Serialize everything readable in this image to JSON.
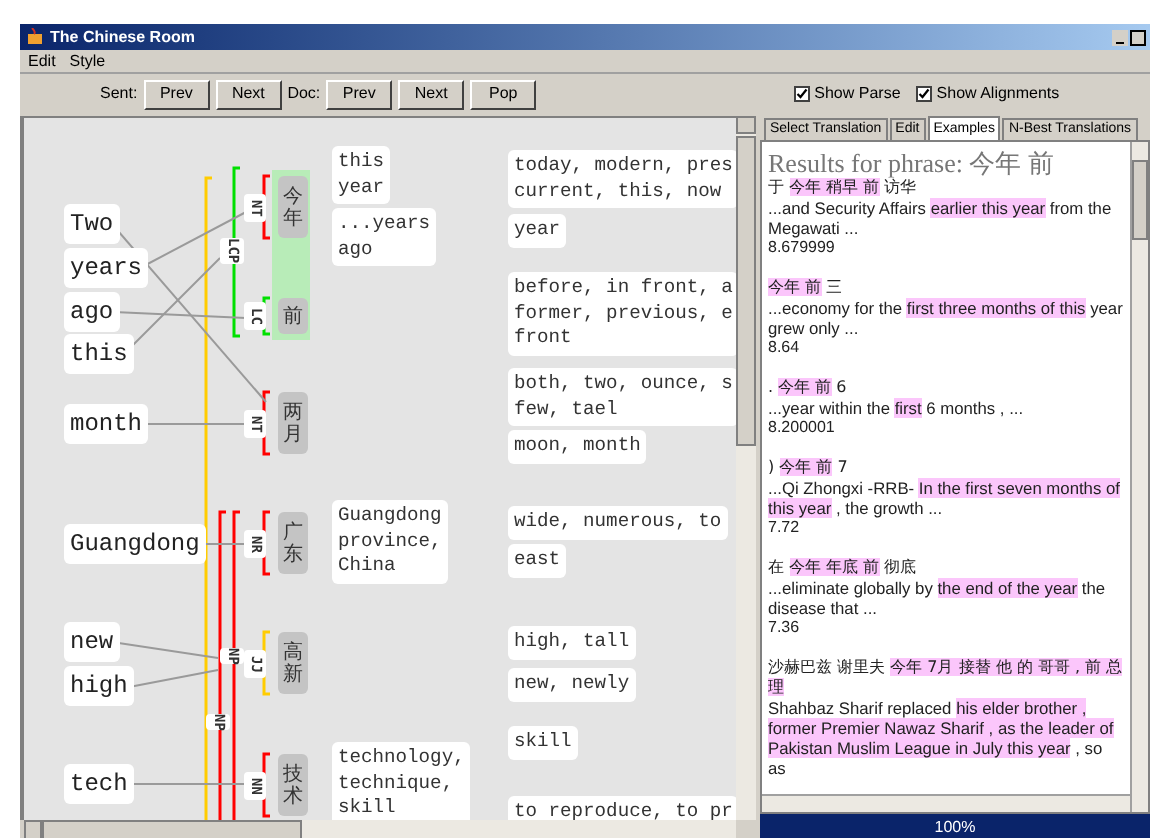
{
  "window": {
    "title": "The Chinese Room"
  },
  "menu": [
    "Edit",
    "Style"
  ],
  "toolbar": {
    "sent_label": "Sent:",
    "sent_buttons": [
      "Prev",
      "Next"
    ],
    "doc_label": "Doc:",
    "doc_buttons": [
      "Prev",
      "Next",
      "Pop"
    ],
    "checkboxes": [
      {
        "label": "Show Parse",
        "checked": true
      },
      {
        "label": "Show Alignments",
        "checked": true
      }
    ]
  },
  "parse": {
    "english_words": [
      {
        "text": "Two"
      },
      {
        "text": "years"
      },
      {
        "text": "ago"
      },
      {
        "text": "this"
      },
      {
        "text": "month"
      },
      {
        "text": "Guangdong"
      },
      {
        "text": "new"
      },
      {
        "text": "high"
      },
      {
        "text": "tech"
      }
    ],
    "chinese_words": [
      {
        "text": "今年",
        "tag": "NT",
        "color": "#ff0000",
        "selected": true
      },
      {
        "text": "前",
        "tag": "LC",
        "color": "#00e000",
        "selected": true
      },
      {
        "text": "两月",
        "tag": "NT",
        "color": "#ff0000",
        "selected": false
      },
      {
        "text": "广东",
        "tag": "NR",
        "color": "#ff0000",
        "selected": false
      },
      {
        "text": "高新",
        "tag": "JJ",
        "color": "#ffcc00",
        "selected": false
      },
      {
        "text": "技术",
        "tag": "NN",
        "color": "#ff0000",
        "selected": false
      }
    ],
    "phrases": [
      {
        "tag": "LCP",
        "color": "#00e000"
      },
      {
        "tag": "NP",
        "color": "#ff0000"
      },
      {
        "tag": "NP",
        "color": "#ff0000"
      },
      {
        "color": "#ffcc00"
      }
    ],
    "glosses": [
      "this\nyear",
      "...years\nago",
      "Guangdong\nprovince,\nChina",
      "technology,\ntechnique,\nskill"
    ],
    "dictionary": [
      "today, modern, pres\ncurrent, this, now",
      "year",
      "before, in front, a\nformer, previous, e\nfront",
      "both, two, ounce, s\nfew, tael",
      "moon, month",
      "wide, numerous, to",
      "east",
      "high, tall",
      "new, newly",
      "skill",
      "to reproduce, to pr"
    ]
  },
  "tabs": [
    {
      "label": "Select Translation",
      "selected": false
    },
    {
      "label": "Edit",
      "selected": false
    },
    {
      "label": "Examples",
      "selected": true
    },
    {
      "label": "N-Best Translations",
      "selected": false
    }
  ],
  "examples": {
    "heading": "Results for phrase: 今年 前",
    "items": [
      {
        "chinese": [
          {
            "text": "于 ",
            "highlighted": false
          },
          {
            "text": "今年 稍早 前",
            "highlighted": true
          },
          {
            "text": " 访华",
            "highlighted": false
          }
        ],
        "english": [
          {
            "text": "...and Security Affairs ",
            "highlighted": false
          },
          {
            "text": "earlier this year",
            "highlighted": true
          },
          {
            "text": " from the Megawati ...",
            "highlighted": false
          }
        ],
        "score": "8.679999"
      },
      {
        "chinese": [
          {
            "text": "今年 前",
            "highlighted": true
          },
          {
            "text": " 三",
            "highlighted": false
          }
        ],
        "english": [
          {
            "text": "...economy for the ",
            "highlighted": false
          },
          {
            "text": "first three months of this",
            "highlighted": true
          },
          {
            "text": " year grew only ...",
            "highlighted": false
          }
        ],
        "score": "8.64"
      },
      {
        "chinese": [
          {
            "text": ". ",
            "highlighted": false
          },
          {
            "text": "今年 前",
            "highlighted": true
          },
          {
            "text": " 6",
            "highlighted": false
          }
        ],
        "english": [
          {
            "text": "...year within the ",
            "highlighted": false
          },
          {
            "text": "first",
            "highlighted": true
          },
          {
            "text": " 6 months , ...",
            "highlighted": false
          }
        ],
        "score": "8.200001"
      },
      {
        "chinese": [
          {
            "text": ") ",
            "highlighted": false
          },
          {
            "text": "今年 前",
            "highlighted": true
          },
          {
            "text": " 7",
            "highlighted": false
          }
        ],
        "english": [
          {
            "text": "...Qi Zhongxi -RRB- ",
            "highlighted": false
          },
          {
            "text": "In the first seven months of this year",
            "highlighted": true
          },
          {
            "text": " , the growth ...",
            "highlighted": false
          }
        ],
        "score": "7.72"
      },
      {
        "chinese": [
          {
            "text": "在 ",
            "highlighted": false
          },
          {
            "text": "今年 年底 前",
            "highlighted": true
          },
          {
            "text": " 彻底",
            "highlighted": false
          }
        ],
        "english": [
          {
            "text": "...eliminate globally by ",
            "highlighted": false
          },
          {
            "text": "the end of the year",
            "highlighted": true
          },
          {
            "text": " the disease that ...",
            "highlighted": false
          }
        ],
        "score": "7.36"
      },
      {
        "chinese": [
          {
            "text": "沙赫巴兹 谢里夫 ",
            "highlighted": false
          },
          {
            "text": "今年 7月 接替 他 的 哥哥 , 前 总理",
            "highlighted": true
          }
        ],
        "english": [
          {
            "text": "Shahbaz Sharif replaced ",
            "highlighted": false
          },
          {
            "text": "his elder brother , former Premier Nawaz Sharif , as the leader of Pakistan Muslim League in July this year",
            "highlighted": true
          },
          {
            "text": " , so as",
            "highlighted": false
          }
        ]
      }
    ]
  },
  "status": "100%"
}
